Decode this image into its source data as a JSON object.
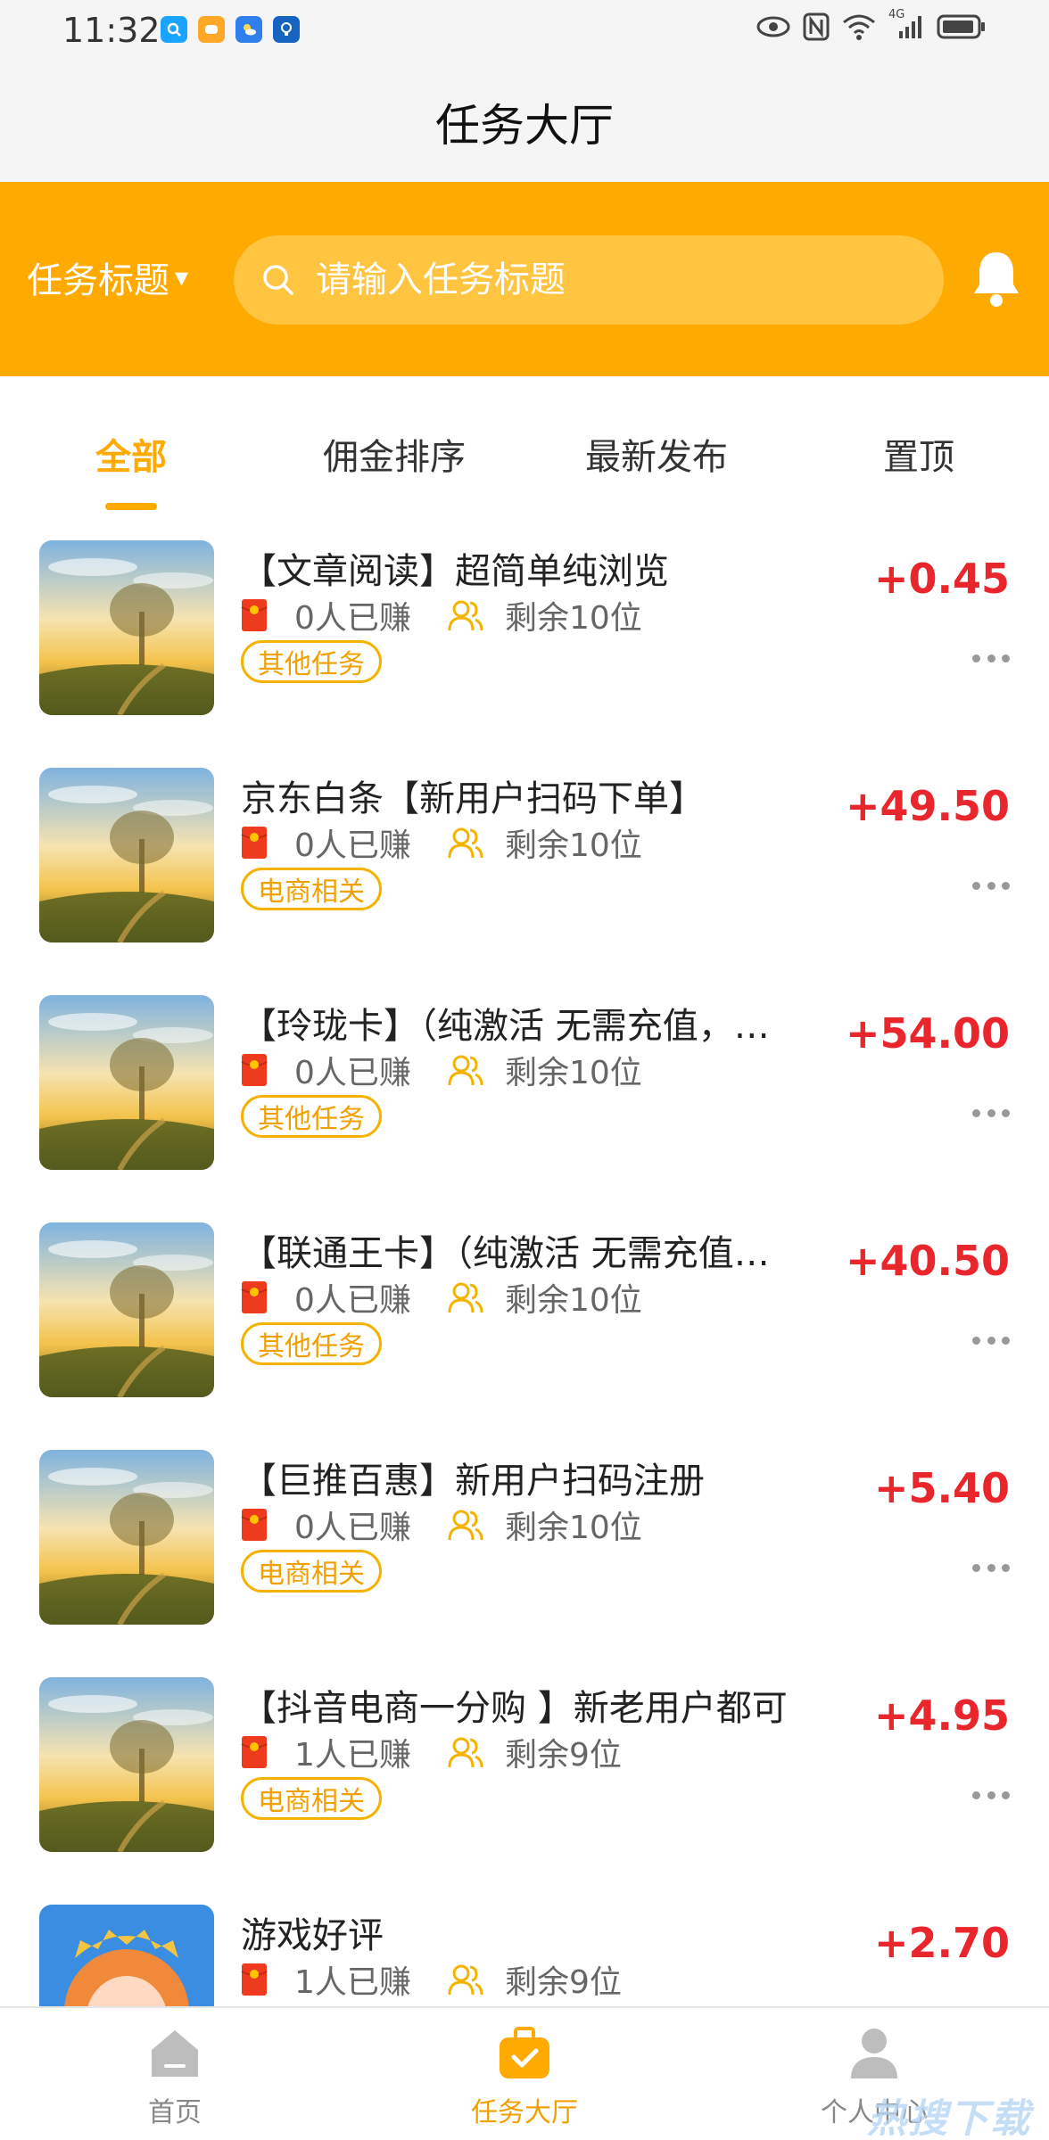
{
  "status_bar": {
    "time": "11:32",
    "network": "4G"
  },
  "header": {
    "title": "任务大厅"
  },
  "search": {
    "filter_label": "任务标题",
    "filter_arrow": "▾",
    "placeholder": "请输入任务标题"
  },
  "tabs": [
    {
      "label": "全部",
      "active": true
    },
    {
      "label": "佣金排序",
      "active": false
    },
    {
      "label": "最新发布",
      "active": false
    },
    {
      "label": "置顶",
      "active": false
    }
  ],
  "tasks": [
    {
      "title": "【文章阅读】超简单纯浏览",
      "earned": "0人已赚",
      "remaining": "剩余10位",
      "category": "其他任务",
      "price": "+0.45",
      "thumb": "landscape"
    },
    {
      "title": "京东白条【新用户扫码下单】",
      "earned": "0人已赚",
      "remaining": "剩余10位",
      "category": "电商相关",
      "price": "+49.50",
      "thumb": "landscape"
    },
    {
      "title": "【玲珑卡】（纯激活 无需充值，…",
      "earned": "0人已赚",
      "remaining": "剩余10位",
      "category": "其他任务",
      "price": "+54.00",
      "thumb": "landscape"
    },
    {
      "title": "【联通王卡】（纯激活 无需充值…",
      "earned": "0人已赚",
      "remaining": "剩余10位",
      "category": "其他任务",
      "price": "+40.50",
      "thumb": "landscape"
    },
    {
      "title": "【巨推百惠】新用户扫码注册",
      "earned": "0人已赚",
      "remaining": "剩余10位",
      "category": "电商相关",
      "price": "+5.40",
      "thumb": "landscape"
    },
    {
      "title": "【抖音电商一分购 】新老用户都可",
      "earned": "1人已赚",
      "remaining": "剩余9位",
      "category": "电商相关",
      "price": "+4.95",
      "thumb": "landscape"
    },
    {
      "title": "游戏好评",
      "earned": "1人已赚",
      "remaining": "剩余9位",
      "category": "",
      "price": "+2.70",
      "thumb": "game"
    }
  ],
  "bottom_nav": [
    {
      "label": "首页",
      "icon": "home-icon",
      "active": false
    },
    {
      "label": "任务大厅",
      "icon": "briefcase-icon",
      "active": true
    },
    {
      "label": "个人中心",
      "icon": "user-icon",
      "active": false
    }
  ],
  "watermark": "热搜下载",
  "colors": {
    "accent": "#ffaa00",
    "price": "#e8262c",
    "badge_border": "#f5b300"
  }
}
